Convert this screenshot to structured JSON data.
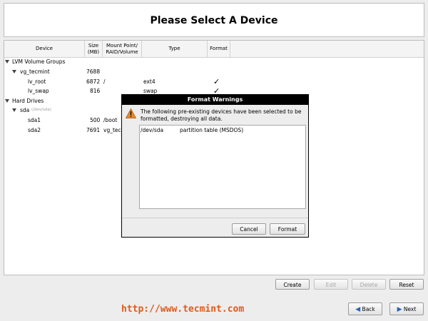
{
  "header": {
    "title": "Please Select A Device"
  },
  "table": {
    "columns": [
      "Device",
      "Size\n(MB)",
      "Mount Point/\nRAID/Volume",
      "Type",
      "Format"
    ],
    "groups": [
      {
        "label": "LVM Volume Groups"
      },
      {
        "label": "vg_tecmint",
        "size": "7688"
      },
      {
        "label": "lv_root",
        "size": "6872",
        "mount": "/",
        "type": "ext4",
        "format": "✓"
      },
      {
        "label": "lv_swap",
        "size": "816",
        "mount": "",
        "type": "swap",
        "format": "✓"
      },
      {
        "label": "Hard Drives"
      },
      {
        "label": "sda",
        "sublabel": "(/dev/sda)"
      },
      {
        "label": "sda1",
        "size": "500",
        "mount": "/boot"
      },
      {
        "label": "sda2",
        "size": "7691",
        "mount": "vg_tec"
      }
    ]
  },
  "actions": {
    "create": "Create",
    "edit": "Edit",
    "delete": "Delete",
    "reset": "Reset"
  },
  "watermark": "http://www.tecmint.com",
  "nav": {
    "back": "Back",
    "next": "Next"
  },
  "dialog": {
    "title": "Format Warnings",
    "message": "The following pre-existing devices have been selected to be formatted, destroying all data.",
    "items": [
      {
        "device": "/dev/sda",
        "description": "partition table (MSDOS)"
      }
    ],
    "cancel": "Cancel",
    "format": "Format"
  },
  "colors": {
    "warning": "#e8892a",
    "watermark": "#e05a1a"
  }
}
